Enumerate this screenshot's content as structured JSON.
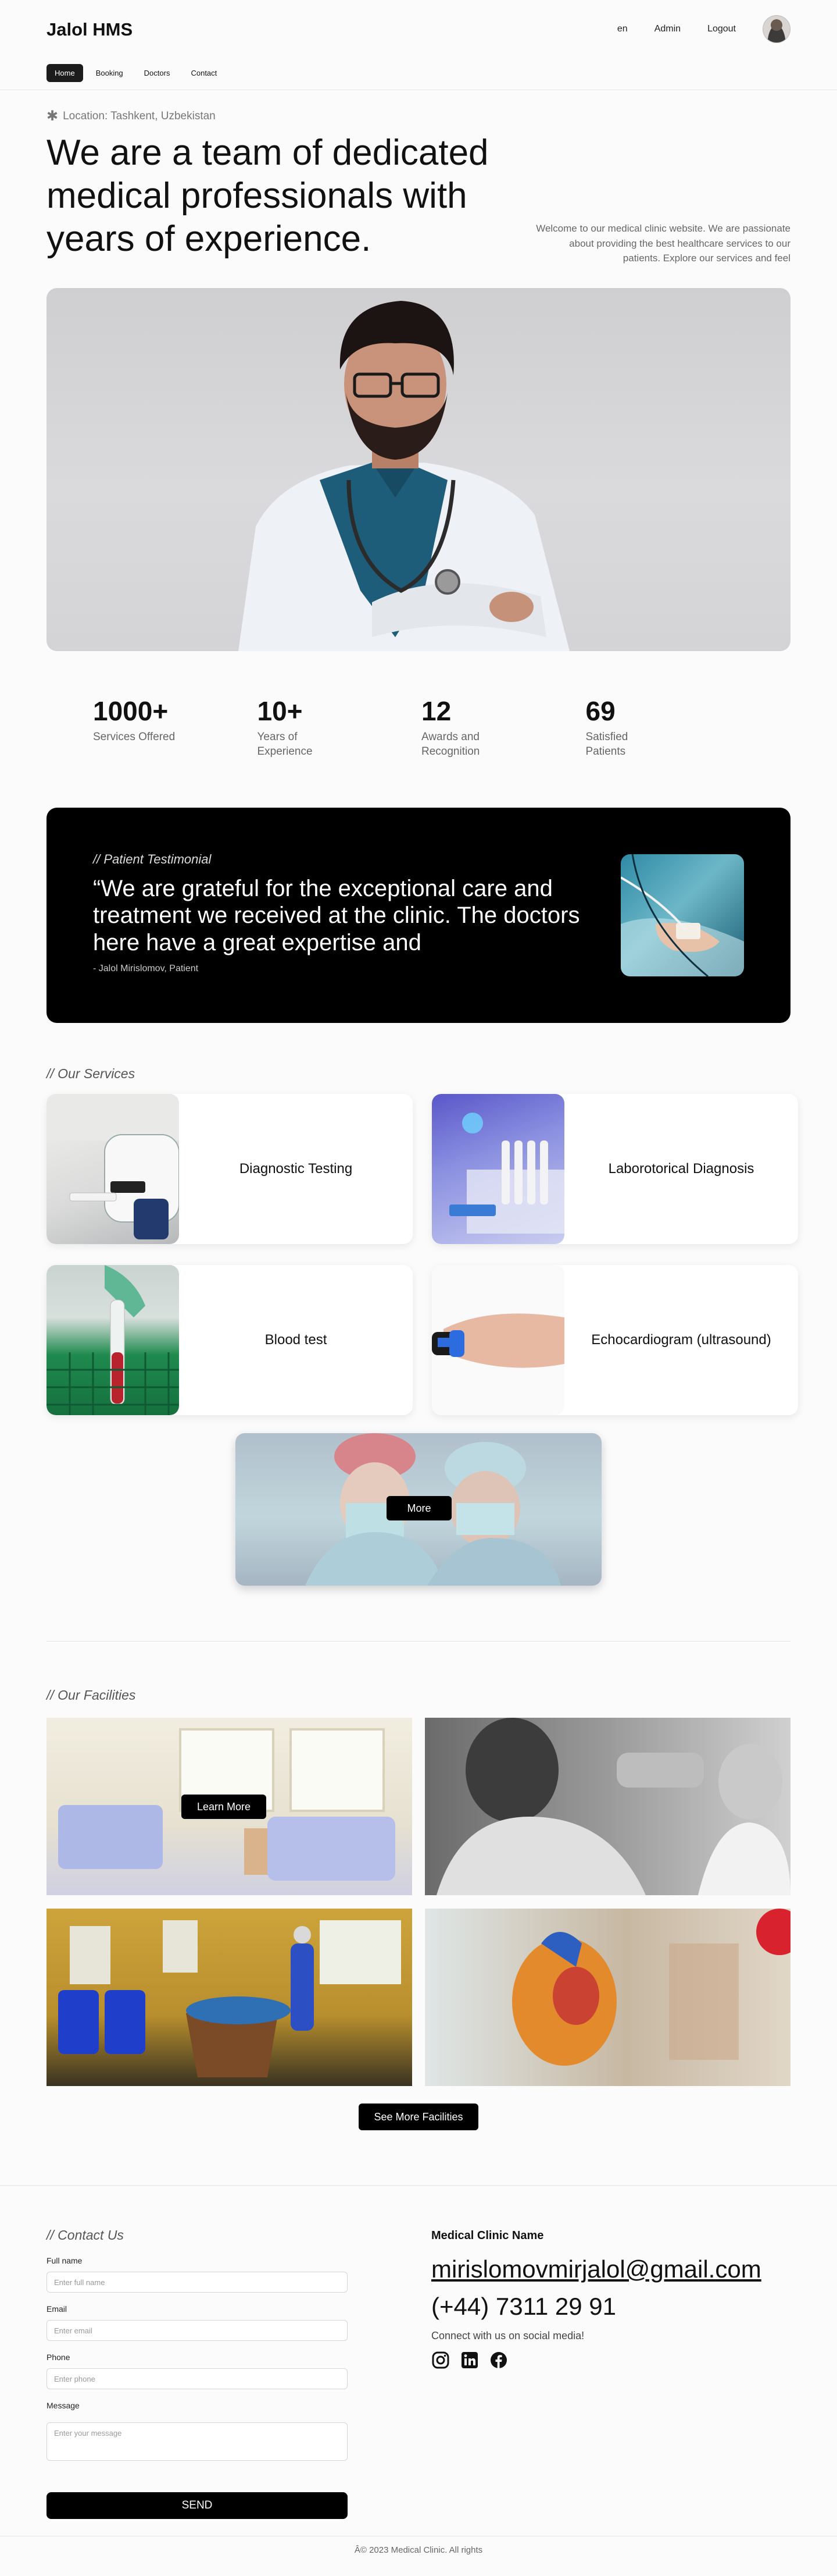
{
  "header": {
    "brand": "Jalol HMS",
    "lang": "en",
    "admin": "Admin",
    "logout": "Logout"
  },
  "subnav": {
    "items": [
      {
        "label": "Home",
        "active": true
      },
      {
        "label": "Booking"
      },
      {
        "label": "Doctors"
      },
      {
        "label": "Contact"
      }
    ]
  },
  "hero": {
    "location": "Location: Tashkent, Uzbekistan",
    "title": "We are a team of dedicated medical professionals with years of experience.",
    "description": "Welcome to our medical clinic website. We are passionate about providing the best healthcare services to our patients. Explore our services and feel"
  },
  "stats": [
    {
      "value": "1000+",
      "label": "Services Offered"
    },
    {
      "value": "10+",
      "label": "Years of Experience"
    },
    {
      "value": "12",
      "label": "Awards and Recognition"
    },
    {
      "value": "69",
      "label": "Satisfied Patients"
    }
  ],
  "testimonial": {
    "tag": "// Patient Testimonial",
    "quote": "“We are grateful for the exceptional care and treatment we received at the clinic. The doctors here have a great expertise and",
    "author": "- Jalol Mirislomov, Patient"
  },
  "services": {
    "tag": "// Our Services",
    "items": [
      {
        "title": "Diagnostic Testing"
      },
      {
        "title": "Laborotorical Diagnosis"
      },
      {
        "title": "Blood test"
      },
      {
        "title": "Echocardiogram (ultrasound)"
      }
    ],
    "more": "More"
  },
  "facilities": {
    "tag": "// Our Facilities",
    "learn_more": "Learn More",
    "see_more": "See More Facilities"
  },
  "contact": {
    "tag": "// Contact Us",
    "fields": [
      {
        "label": "Full name",
        "placeholder": "Enter full name"
      },
      {
        "label": "Email",
        "placeholder": "Enter email"
      },
      {
        "label": "Phone",
        "placeholder": "Enter phone"
      },
      {
        "label": "Message",
        "placeholder": "Enter your message"
      }
    ],
    "send": "SEND",
    "clinic_name": "Medical Clinic Name",
    "email": "mirislomovmirjalol@gmail.com",
    "phone": "(+44) 7311 29 91",
    "social_text": "Connect with us on social media!"
  },
  "footer": {
    "copyright": "Â© 2023 Medical Clinic. All rights"
  }
}
